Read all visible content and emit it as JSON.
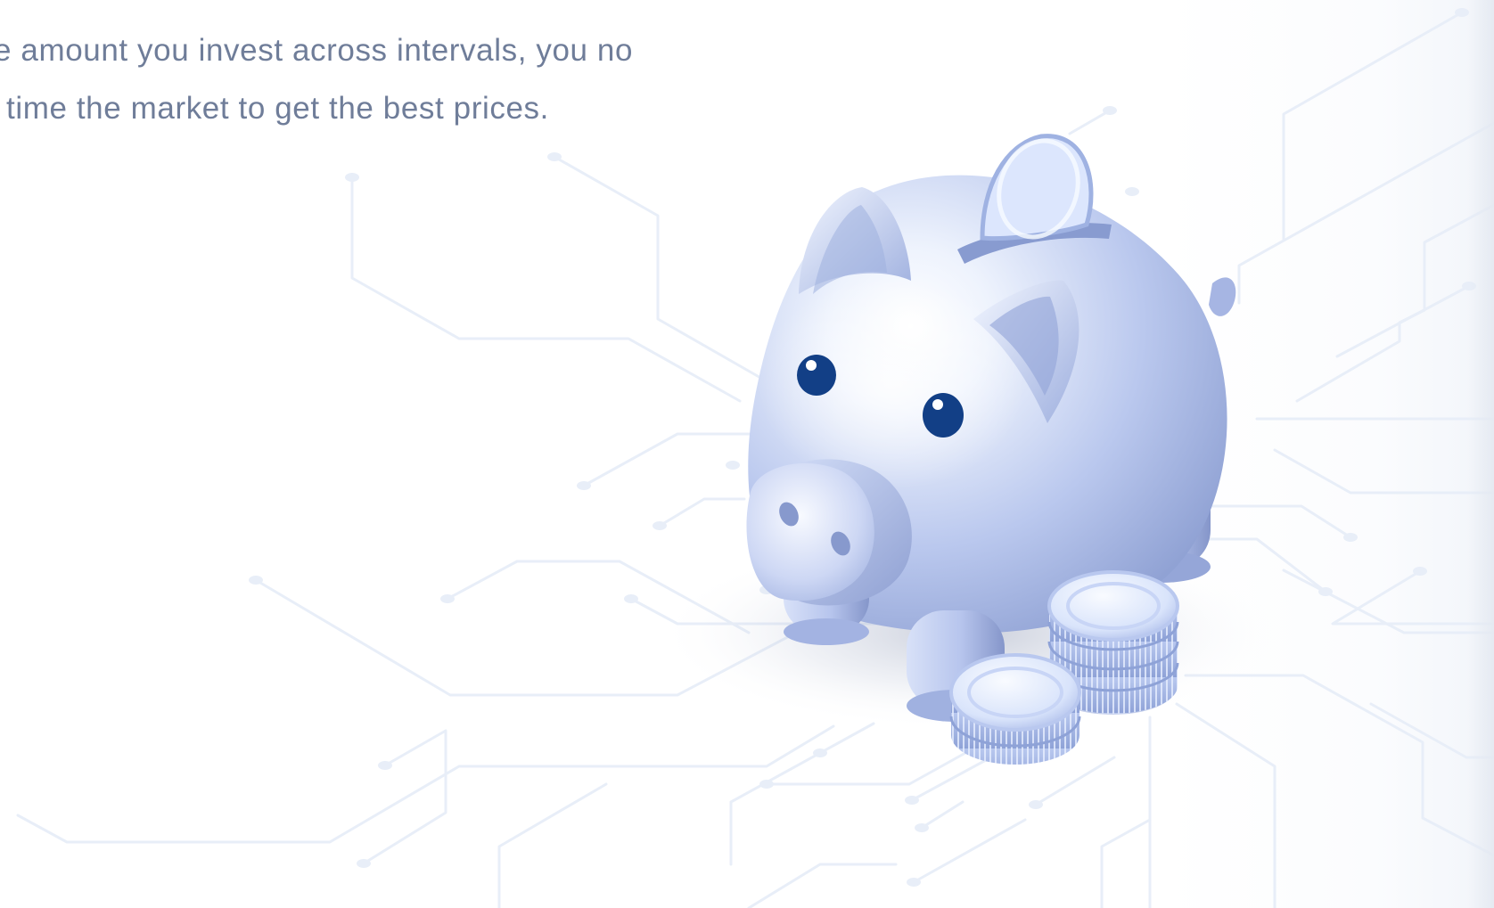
{
  "hero": {
    "body_lines": [
      "e amount you invest across intervals, you no",
      "time the market to get the best prices."
    ]
  },
  "illustration": {
    "subject": "piggy-bank",
    "icons": [
      "circuit-lines",
      "piggy-bank-icon",
      "coin-icon",
      "coin-stack-icon"
    ],
    "colors": {
      "circuit": "#e8eef8",
      "body": "#a9b8e3",
      "body_light": "#f4f7fe",
      "eye": "#123f86",
      "text": "#6f7d99"
    }
  }
}
